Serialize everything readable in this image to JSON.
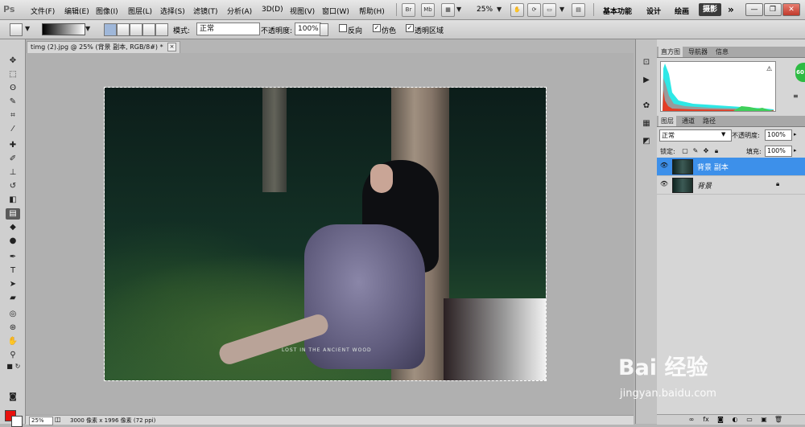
{
  "app": {
    "logo": "Ps"
  },
  "menu": [
    "文件(F)",
    "编辑(E)",
    "图像(I)",
    "图层(L)",
    "选择(S)",
    "滤镜(T)",
    "分析(A)",
    "3D(D)",
    "视图(V)",
    "窗口(W)",
    "帮助(H)"
  ],
  "menubar_icons": {
    "bridge": "Br",
    "minibridge": "Mb",
    "zoom": "25%"
  },
  "workspaces": {
    "essentials": "基本功能",
    "design": "设计",
    "painting": "绘画",
    "photography": "摄影",
    "more": "»"
  },
  "window_controls": {
    "minimize": "—",
    "restore": "❐",
    "close": "✕"
  },
  "options": {
    "mode_label": "模式:",
    "mode_value": "正常",
    "opacity_label": "不透明度:",
    "opacity_value": "100%",
    "reverse_label": "反向",
    "dither_label": "仿色",
    "transparency_label": "透明区域",
    "reverse_checked": "",
    "dither_checked": "✓",
    "transparency_checked": "✓"
  },
  "document": {
    "tab_title": "timg (2).jpg @ 25% (背景 副本, RGB/8#) *",
    "tab_close": "×",
    "photo_caption": "LOST IN THE ANCIENT WOOD"
  },
  "status": {
    "zoom": "25%",
    "doc_info": "3000 像素 x 1996 像素 (72 ppi)"
  },
  "panels": {
    "top_tabs": [
      "直方图",
      "导航器",
      "信息"
    ],
    "histogram_warning": "⚠",
    "layer_tabs": [
      "图层",
      "通道",
      "路径"
    ],
    "blend_mode": "正常",
    "opacity_label": "不透明度:",
    "opacity_value": "100%",
    "lock_label": "锁定:",
    "fill_label": "填充:",
    "fill_value": "100%",
    "layers": [
      {
        "name": "背景 副本",
        "selected": true
      },
      {
        "name": "背景",
        "selected": false,
        "locked": true
      }
    ]
  },
  "badge": "60",
  "watermark": {
    "logo": "Bai 经验",
    "url": "jingyan.baidu.com"
  },
  "colors": {
    "foreground": "#e8110d",
    "background": "#ffffff",
    "selection": "#3d90ea",
    "accent_badge": "#2dbb43"
  }
}
